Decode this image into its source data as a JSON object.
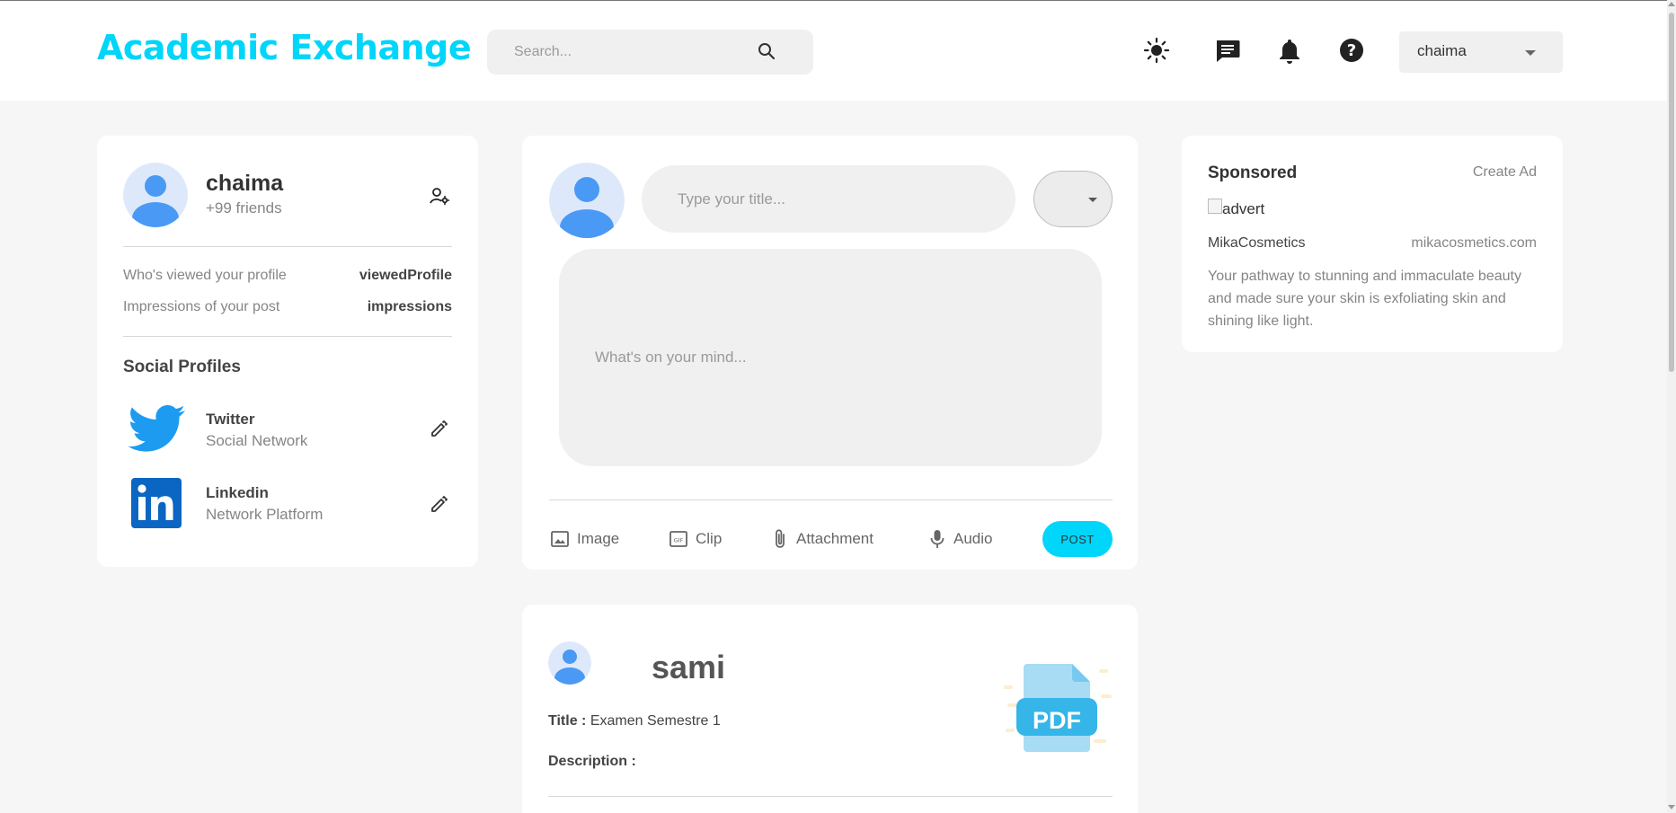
{
  "header": {
    "logo": "Academic Exchange",
    "search_placeholder": "Search...",
    "user_name": "chaima",
    "icons": [
      "search-icon",
      "light-mode-icon",
      "message-icon",
      "notification-bell-icon",
      "help-icon",
      "dropdown-caret-icon"
    ]
  },
  "colors": {
    "brand": "#00d5fa",
    "avatar": "#4a99f5",
    "avatar_bg": "#dde9fb",
    "background": "#f6f6f6",
    "card": "#ffffff",
    "input": "#f0f0f0"
  },
  "profile": {
    "name": "chaima",
    "friends": "+99 friends",
    "stats": [
      {
        "label": "Who's viewed your profile",
        "value": "viewedProfile"
      },
      {
        "label": "Impressions of your post",
        "value": "impressions"
      }
    ],
    "social_heading": "Social Profiles",
    "socials": [
      {
        "name": "Twitter",
        "type": "Social Network",
        "icon": "twitter-icon"
      },
      {
        "name": "Linkedin",
        "type": "Network Platform",
        "icon": "linkedin-icon"
      }
    ]
  },
  "composer": {
    "title_placeholder": "Type your title...",
    "body_placeholder": "What's on your mind...",
    "actions": [
      {
        "label": "Image",
        "icon": "image-icon"
      },
      {
        "label": "Clip",
        "icon": "gif-icon"
      },
      {
        "label": "Attachment",
        "icon": "attachment-icon"
      },
      {
        "label": "Audio",
        "icon": "microphone-icon"
      }
    ],
    "post_label": "POST"
  },
  "feed_post": {
    "author": "sami",
    "title_label": "Title :",
    "title_value": "Examen Semestre 1",
    "description_label": "Description :",
    "file_badge": "PDF"
  },
  "sponsored": {
    "heading": "Sponsored",
    "create_ad": "Create Ad",
    "image_alt": "advert",
    "company": "MikaCosmetics",
    "site": "mikacosmetics.com",
    "description": "Your pathway to stunning and immaculate beauty and made sure your skin is exfoliating skin and shining like light."
  }
}
